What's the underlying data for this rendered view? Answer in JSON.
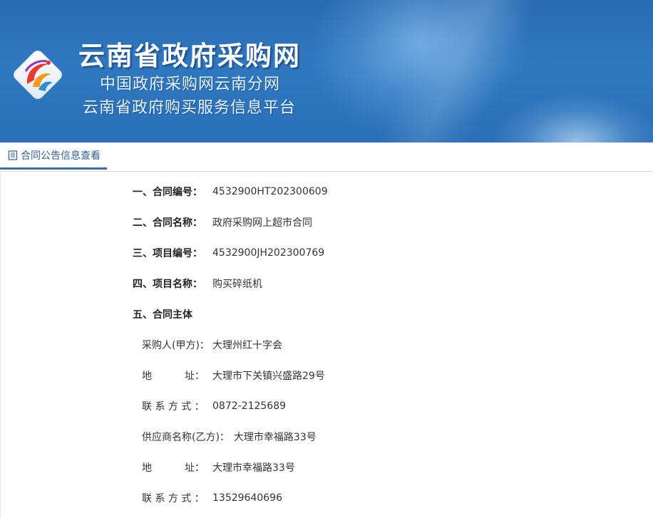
{
  "header": {
    "title": "云南省政府采购网",
    "subtitle1": "中国政府采购网云南分网",
    "subtitle2": "云南省政府购买服务信息平台"
  },
  "tab": {
    "label": "合同公告信息查看",
    "icon": "document-icon",
    "accent": "#2f6fb1"
  },
  "fields": [
    {
      "label": "一、合同编号：",
      "value": "4532900HT202300609"
    },
    {
      "label": "二、合同名称：",
      "value": "政府采购网上超市合同"
    },
    {
      "label": "三、项目编号：",
      "value": "4532900JH202300769"
    },
    {
      "label": "四、项目名称：",
      "value": "购买碎纸机"
    },
    {
      "label": "五、合同主体",
      "value": ""
    }
  ],
  "party": {
    "buyer_label": "采购人(甲方)：",
    "buyer_value": "大理州红十字会",
    "buyer_addr_label_a": "地",
    "buyer_addr_label_b": "址：",
    "buyer_addr_value": "大理市下关镇兴盛路29号",
    "buyer_contact_label": "联 系 方 式 ：",
    "buyer_contact_value": "0872-2125689",
    "supplier_label": "供应商名称(乙方)：",
    "supplier_value": "大理市幸福路33号",
    "supplier_addr_label_a": "地",
    "supplier_addr_label_b": "址：",
    "supplier_addr_value": "大理市幸福路33号",
    "supplier_contact_label": "联 系 方 式 ：",
    "supplier_contact_value": "13529640696"
  }
}
